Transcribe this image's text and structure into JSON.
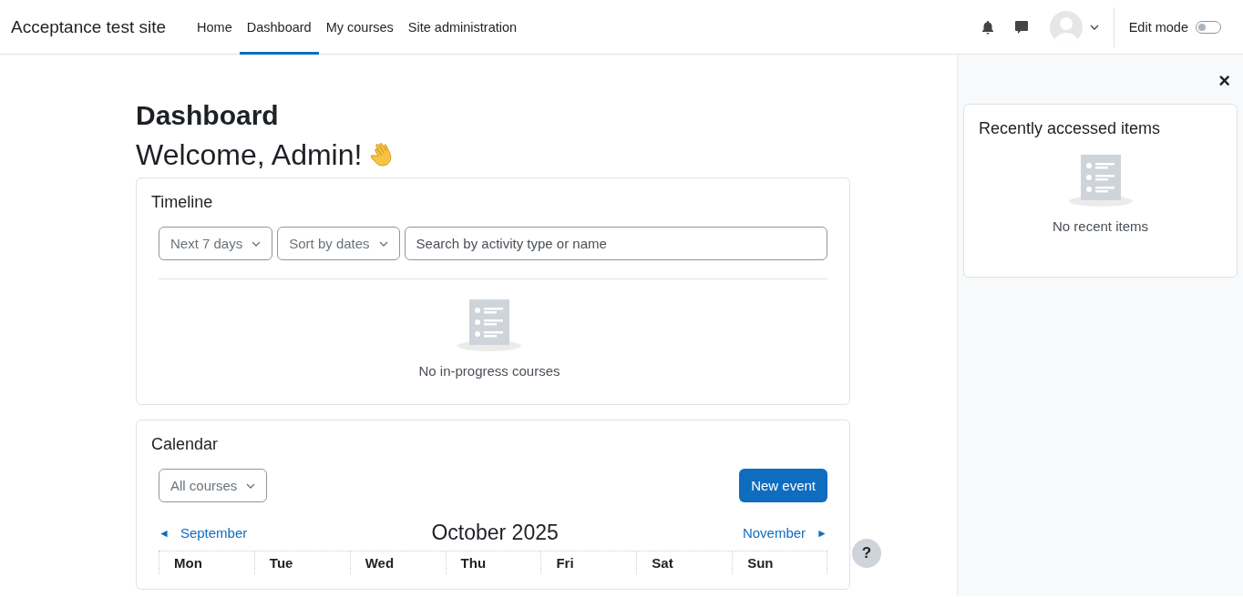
{
  "navbar": {
    "site_name": "Acceptance test site",
    "nav_items": [
      {
        "label": "Home",
        "selected": false
      },
      {
        "label": "Dashboard",
        "selected": true
      },
      {
        "label": "My courses",
        "selected": false
      },
      {
        "label": "Site administration",
        "selected": false
      }
    ],
    "edit_mode": {
      "label": "Edit mode",
      "on": false
    }
  },
  "page": {
    "title": "Dashboard",
    "welcome": "Welcome, Admin!"
  },
  "timeline": {
    "title": "Timeline",
    "filter": "Next 7 days",
    "sort": "Sort by dates",
    "search": {
      "placeholder": "Search by activity type or name"
    },
    "empty": "No in-progress courses"
  },
  "calendar": {
    "title": "Calendar",
    "course_filter": "All courses",
    "new_event": "New event",
    "prev_month": "September",
    "prev_arrow": "◄",
    "month": "October 2025",
    "next_month": "November",
    "next_arrow": "►",
    "weekdays": [
      "Mon",
      "Tue",
      "Wed",
      "Thu",
      "Fri",
      "Sat",
      "Sun"
    ]
  },
  "help": "?",
  "drawer": {
    "close": "×",
    "block_title": "Recently accessed items",
    "empty": "No recent items"
  }
}
